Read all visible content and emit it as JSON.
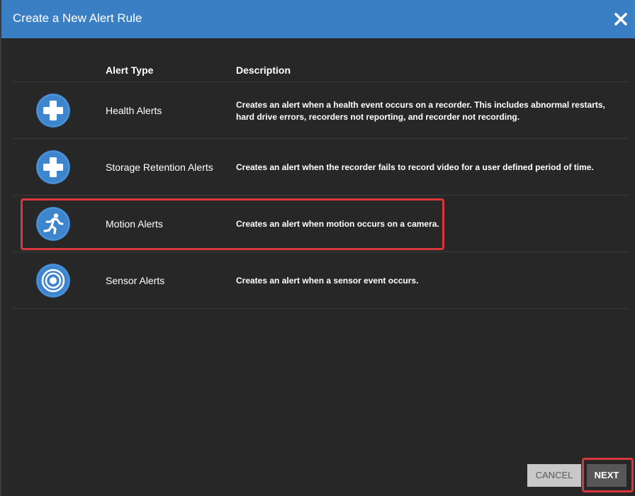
{
  "dialog": {
    "title": "Create a New Alert Rule",
    "close_icon": "close-x-icon"
  },
  "table": {
    "headers": {
      "type": "Alert Type",
      "description": "Description"
    },
    "rows": [
      {
        "icon": "plus-icon",
        "name": "Health Alerts",
        "description": "Creates an alert when a health event occurs on a recorder. This includes abnormal restarts, hard drive errors, recorders not reporting, and recorder not recording."
      },
      {
        "icon": "plus-icon",
        "name": "Storage Retention Alerts",
        "description": "Creates an alert when the recorder fails to record video for a user defined period of time."
      },
      {
        "icon": "running-person-icon",
        "name": "Motion Alerts",
        "description": "Creates an alert when motion occurs on a camera."
      },
      {
        "icon": "concentric-circles-icon",
        "name": "Sensor Alerts",
        "description": "Creates an alert when a sensor event occurs."
      }
    ]
  },
  "footer": {
    "cancel_label": "CANCEL",
    "next_label": "NEXT"
  },
  "colors": {
    "titlebar": "#3a7ec4",
    "background": "#272727",
    "icon_circle": "#3d86ce",
    "highlight": "#d9363e"
  }
}
